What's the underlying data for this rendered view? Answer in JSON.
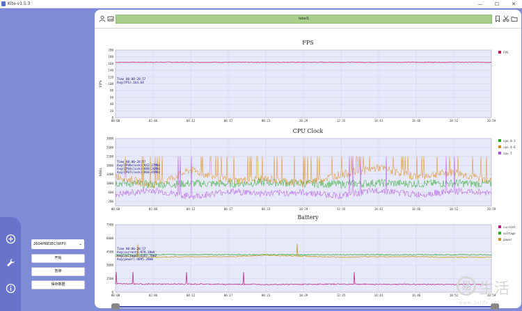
{
  "window": {
    "title": "Kite-v1.5.3",
    "minimize": "—",
    "maximize": "☐",
    "close": "✕"
  },
  "toolbar": {
    "label": "label1"
  },
  "left_panel": {
    "device": "2604PRE3EC(WIFI)",
    "buttons": {
      "start": "开始",
      "pause": "暂停",
      "save": "保存数据"
    }
  },
  "time_ticks": [
    "00:00",
    "02:06",
    "04:12",
    "06:17",
    "08:23",
    "10:29",
    "12:35",
    "14:41",
    "16:46",
    "18:52",
    "20:59"
  ],
  "colors": {
    "fps": "#c2185b",
    "cpu0": "#22aa22",
    "cpu4": "#d98c14",
    "cpu7": "#b04ee0",
    "current": "#b51c7a",
    "voltage": "#22b022",
    "power": "#c8951c",
    "sidebar": "#7f8bd6",
    "label_bar": "#a9cf8c",
    "plot_bg": "#e8e8fb"
  },
  "chart_data": [
    {
      "type": "line",
      "title": "FPS",
      "ylabel": "FPS",
      "ylim": [
        0,
        200
      ],
      "yticks": [
        "200",
        "180",
        "160",
        "140",
        "120",
        "100",
        "80",
        "60",
        "40",
        "20",
        "0"
      ],
      "x": [
        "00:00",
        "02:06",
        "04:12",
        "06:17",
        "08:23",
        "10:29",
        "12:35",
        "14:41",
        "16:46",
        "18:52",
        "20:59"
      ],
      "series": [
        {
          "name": "FPS",
          "values": [
            164,
            164,
            164,
            164,
            164,
            164,
            164,
            164,
            164,
            164,
            164
          ]
        }
      ],
      "annotation": [
        "Time 00:00-20:57",
        "Avg(FPS):164.64"
      ],
      "legend_position": "top-right",
      "grid": true
    },
    {
      "type": "line",
      "title": "CPU Clock",
      "ylabel": "MHz",
      "ylim": [
        0,
        3000
      ],
      "yticks": [
        "3000",
        "2600",
        "2200",
        "1800",
        "1400",
        "1000",
        "600",
        "200"
      ],
      "x": [
        "00:00",
        "02:06",
        "04:12",
        "06:17",
        "08:23",
        "10:29",
        "12:35",
        "14:41",
        "16:46",
        "18:52",
        "20:59"
      ],
      "series": [
        {
          "name": "cpu 0-3",
          "values": [
            1030,
            950,
            1000,
            980,
            1050,
            1000,
            970,
            1020,
            990,
            1010,
            980
          ]
        },
        {
          "name": "cpu 4-6",
          "values": [
            1350,
            900,
            1600,
            1100,
            1200,
            1000,
            1400,
            1700,
            1300,
            1500,
            1100
          ]
        },
        {
          "name": "cpu 7",
          "values": [
            500,
            700,
            400,
            650,
            550,
            600,
            450,
            700,
            500,
            650,
            600
          ]
        }
      ],
      "annotation": [
        "Time 00:00-20:57",
        "Avg(CPU0clock):942.37MHz",
        "Avg(CPU4clock):889.26MHz",
        "Avg(CPU7clock):868.45MHz"
      ],
      "legend_position": "top-right",
      "grid": true
    },
    {
      "type": "line",
      "title": "Battery",
      "ylim": [
        0,
        7500
      ],
      "yticks": [
        "7500",
        "6000",
        "4500",
        "3000",
        "1500",
        "0"
      ],
      "x": [
        "00:00",
        "02:06",
        "04:12",
        "06:17",
        "08:23",
        "10:29",
        "12:35",
        "14:41",
        "16:46",
        "18:52",
        "20:59"
      ],
      "series": [
        {
          "name": "current",
          "values": [
            950,
            900,
            900,
            880,
            880,
            880,
            900,
            880,
            880,
            870,
            870
          ]
        },
        {
          "name": "voltage",
          "values": [
            4180,
            4180,
            4175,
            4175,
            4170,
            4170,
            4170,
            4165,
            4165,
            4160,
            4160
          ]
        },
        {
          "name": "power",
          "values": [
            4000,
            3900,
            3950,
            3950,
            4100,
            4000,
            3900,
            3950,
            3950,
            3900,
            3900
          ]
        }
      ],
      "annotation": [
        "Time 00:00-20:57",
        "Avg(current):979.39mA",
        "Avg(voltage):4197.76mV",
        "Avg(power):4095.28mW"
      ],
      "legend_position": "top-right",
      "grid": true
    }
  ],
  "watermark": {
    "glyph": "易",
    "text": "生活",
    "url": "www.3elife.net"
  }
}
